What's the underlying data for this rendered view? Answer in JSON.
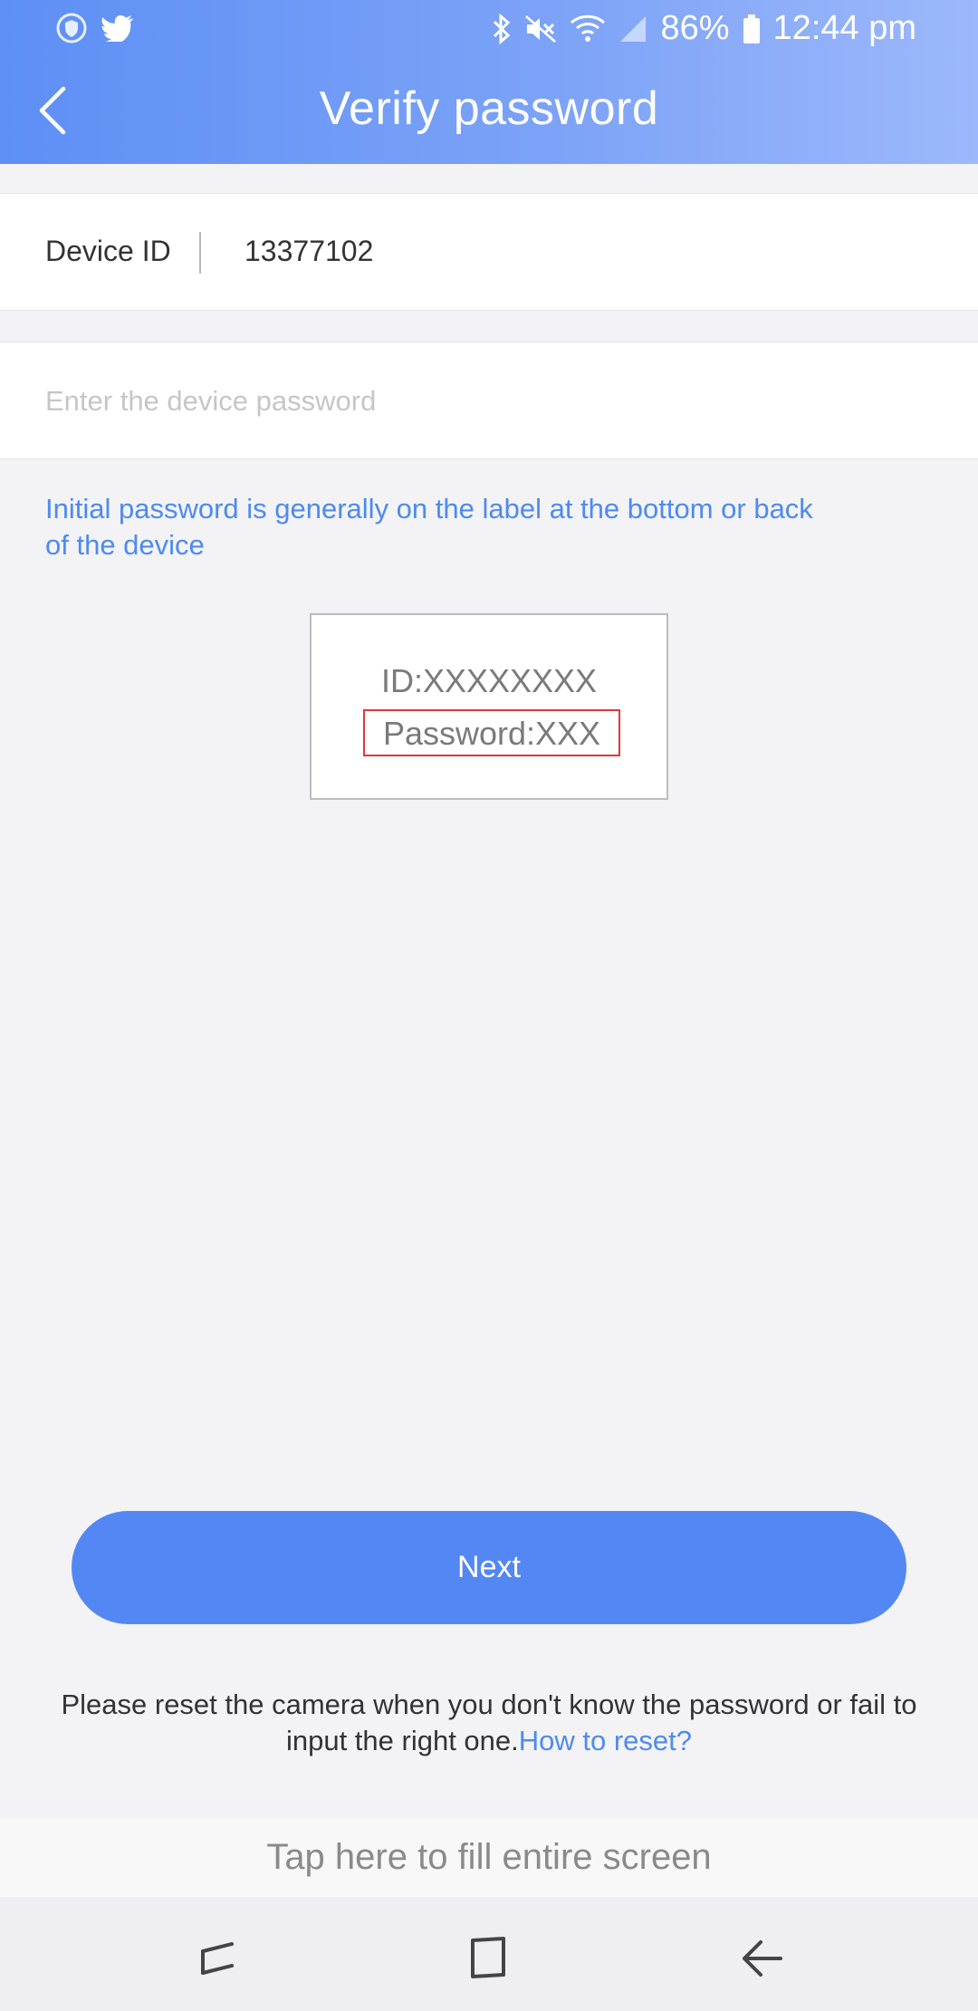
{
  "status_bar": {
    "battery": "86%",
    "time": "12:44 pm",
    "left_icons": [
      "vpn-shield-icon",
      "twitter-icon"
    ],
    "right_icons": [
      "bluetooth-icon",
      "mute-icon",
      "wifi-icon",
      "signal-icon",
      "battery-icon"
    ]
  },
  "header": {
    "title": "Verify password",
    "back_icon": "chevron-left-icon",
    "colors": {
      "gradient_start": "#5e8ff5",
      "gradient_end": "#9db8fb"
    }
  },
  "form": {
    "device_id_label": "Device ID",
    "device_id_value": "13377102",
    "password_placeholder": "Enter the device password",
    "password_value": ""
  },
  "hint": "Initial password is generally on the label at the bottom or back of the device",
  "label_example": {
    "id_text": "ID:XXXXXXXX",
    "password_text": "Password:XXX"
  },
  "actions": {
    "next_label": "Next",
    "reset_note": "Please reset the camera when you don't know the password or fail to input the right one.",
    "reset_link": "How to reset?"
  },
  "fill_screen": "Tap here to fill entire screen",
  "nav": {
    "items": [
      "recents-icon",
      "home-icon",
      "back-icon"
    ]
  },
  "accent_color": "#5387f4"
}
